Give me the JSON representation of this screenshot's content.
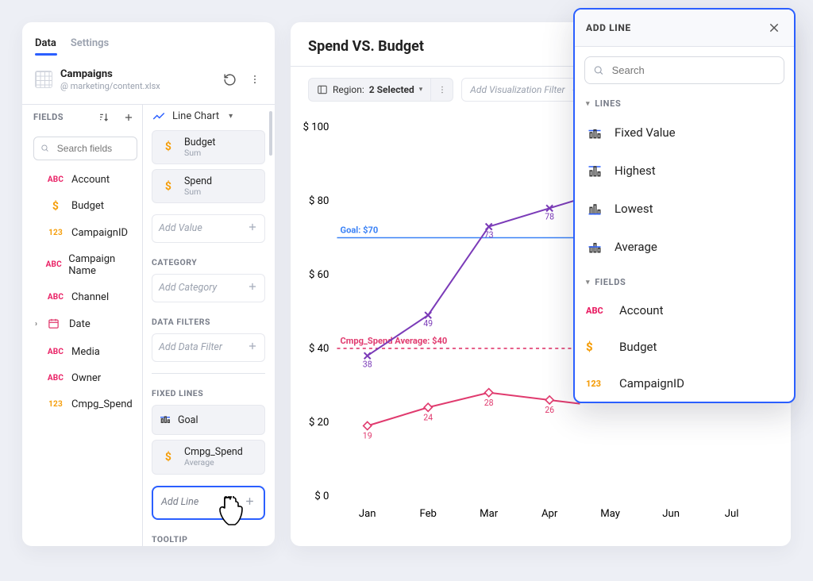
{
  "tabs": {
    "data": "Data",
    "settings": "Settings"
  },
  "datasource": {
    "title": "Campaigns",
    "subtitle": "@ marketing/content.xlsx"
  },
  "fields": {
    "header": "FIELDS",
    "search_placeholder": "Search fields",
    "items": [
      {
        "type": "ABC",
        "label": "Account"
      },
      {
        "type": "$",
        "label": "Budget"
      },
      {
        "type": "123",
        "label": "CampaignID"
      },
      {
        "type": "ABC",
        "label": "Campaign Name"
      },
      {
        "type": "ABC",
        "label": "Channel"
      },
      {
        "type": "date",
        "label": "Date",
        "expandable": true
      },
      {
        "type": "ABC",
        "label": "Media"
      },
      {
        "type": "ABC",
        "label": "Owner"
      },
      {
        "type": "123",
        "label": "Cmpg_Spend"
      }
    ]
  },
  "config": {
    "chart_type": "Line Chart",
    "values": [
      {
        "title": "Budget",
        "sub": "Sum",
        "icon": "$"
      },
      {
        "title": "Spend",
        "sub": "Sum",
        "icon": "$"
      }
    ],
    "add_value": "Add Value",
    "category_header": "CATEGORY",
    "add_category": "Add Category",
    "filters_header": "DATA FILTERS",
    "add_filter": "Add Data Filter",
    "fixed_header": "FIXED LINES",
    "fixed": [
      {
        "title": "Goal",
        "icon": "bars-goal"
      },
      {
        "title": "Cmpg_Spend",
        "sub": "Average",
        "icon": "$"
      }
    ],
    "add_line": "Add Line",
    "tooltip_header": "TOOLTIP"
  },
  "chart": {
    "title": "Spend VS. Budget",
    "filter_label": "Region:",
    "filter_value": "2 Selected",
    "add_viz_filter": "Add Visualization Filter"
  },
  "chart_data": {
    "type": "line",
    "title": "Spend VS. Budget",
    "xlabel": "",
    "ylabel": "",
    "ylim": [
      0,
      100
    ],
    "yticks": [
      0,
      20,
      40,
      60,
      80,
      100
    ],
    "ytick_prefix": "$ ",
    "categories": [
      "Jan",
      "Feb",
      "Mar",
      "Apr",
      "May",
      "Jun",
      "Jul"
    ],
    "series": [
      {
        "name": "Budget",
        "marker": "x",
        "color": "#7b3bb8",
        "values": [
          38,
          49,
          73,
          78,
          null,
          null,
          null
        ]
      },
      {
        "name": "Spend",
        "marker": "diamond",
        "color": "#e03a6e",
        "values": [
          19,
          24,
          28,
          26,
          null,
          null,
          null
        ]
      }
    ],
    "fixed_lines": [
      {
        "name": "Goal",
        "value": 70,
        "label": "Goal: $70",
        "style": "solid",
        "color": "#3b82f6"
      },
      {
        "name": "Cmpg_Spend Average",
        "value": 40,
        "label": "Cmpg_Spend Average: $40",
        "style": "dashed",
        "color": "#e03a6e"
      }
    ]
  },
  "popover": {
    "title": "ADD LINE",
    "search_placeholder": "Search",
    "lines_header": "LINES",
    "lines": [
      {
        "label": "Fixed Value",
        "icon": "fixed"
      },
      {
        "label": "Highest",
        "icon": "highest"
      },
      {
        "label": "Lowest",
        "icon": "lowest"
      },
      {
        "label": "Average",
        "icon": "average"
      }
    ],
    "fields_header": "FIELDS",
    "fields": [
      {
        "type": "ABC",
        "label": "Account"
      },
      {
        "type": "$",
        "label": "Budget"
      },
      {
        "type": "123",
        "label": "CampaignID"
      }
    ]
  }
}
